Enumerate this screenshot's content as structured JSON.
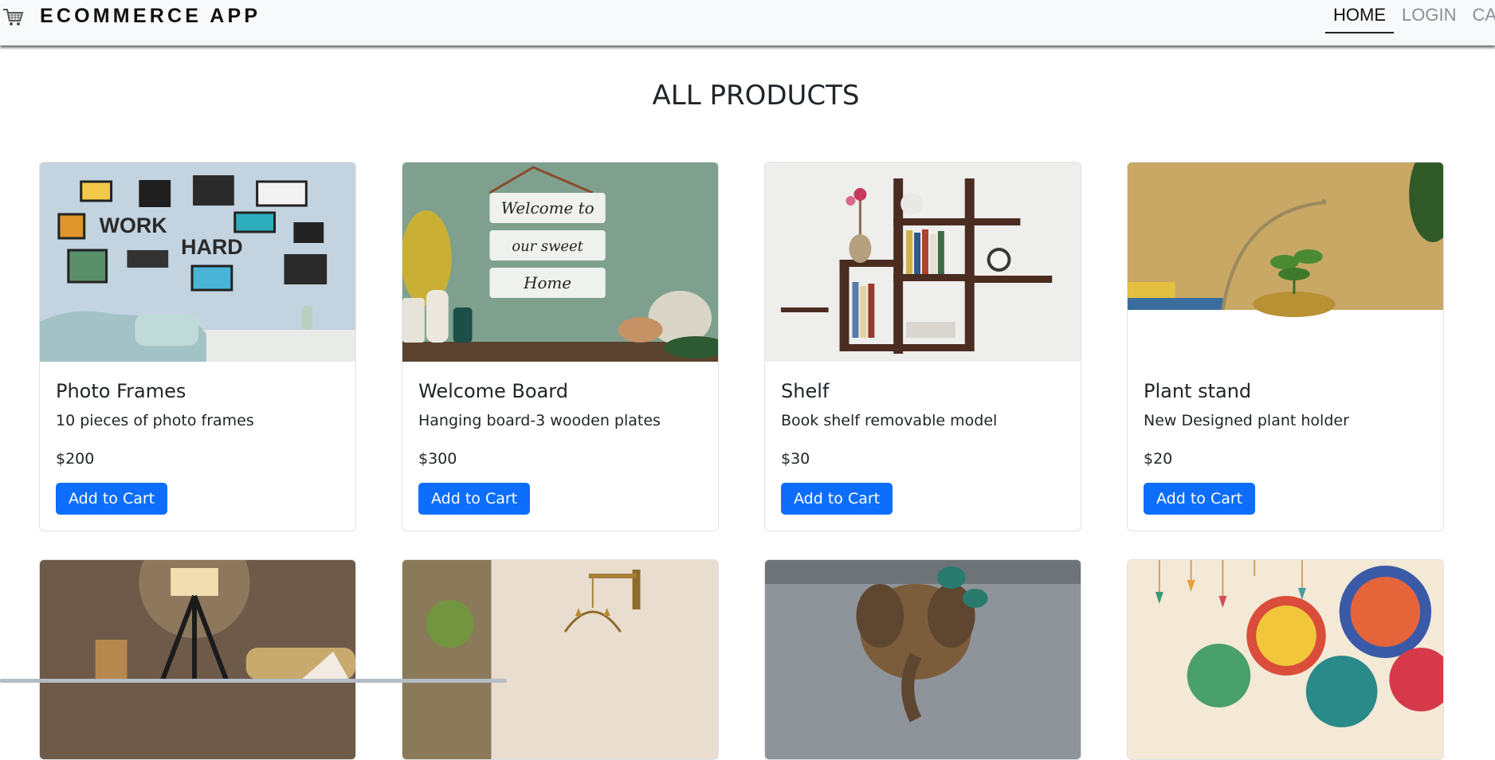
{
  "navbar": {
    "brand": "ECOMMERCE APP",
    "brand_icon": "shopping-cart-icon",
    "links": [
      {
        "label": "HOME",
        "active": true
      },
      {
        "label": "LOGIN",
        "active": false
      },
      {
        "label": "CART",
        "active": false
      }
    ]
  },
  "page": {
    "title": "ALL PRODUCTS"
  },
  "products": [
    {
      "name": "Photo Frames",
      "description": "10 pieces of photo frames",
      "price": "$200",
      "button": "Add to Cart"
    },
    {
      "name": "Welcome Board",
      "description": "Hanging board-3 wooden plates",
      "price": "$300",
      "button": "Add to Cart"
    },
    {
      "name": "Shelf",
      "description": "Book shelf removable model",
      "price": "$30",
      "button": "Add to Cart"
    },
    {
      "name": "Plant stand",
      "description": "New Designed plant holder",
      "price": "$20",
      "button": "Add to Cart"
    }
  ],
  "colors": {
    "accent": "#0d6efd",
    "navbar_bg": "#f8f9fa"
  }
}
